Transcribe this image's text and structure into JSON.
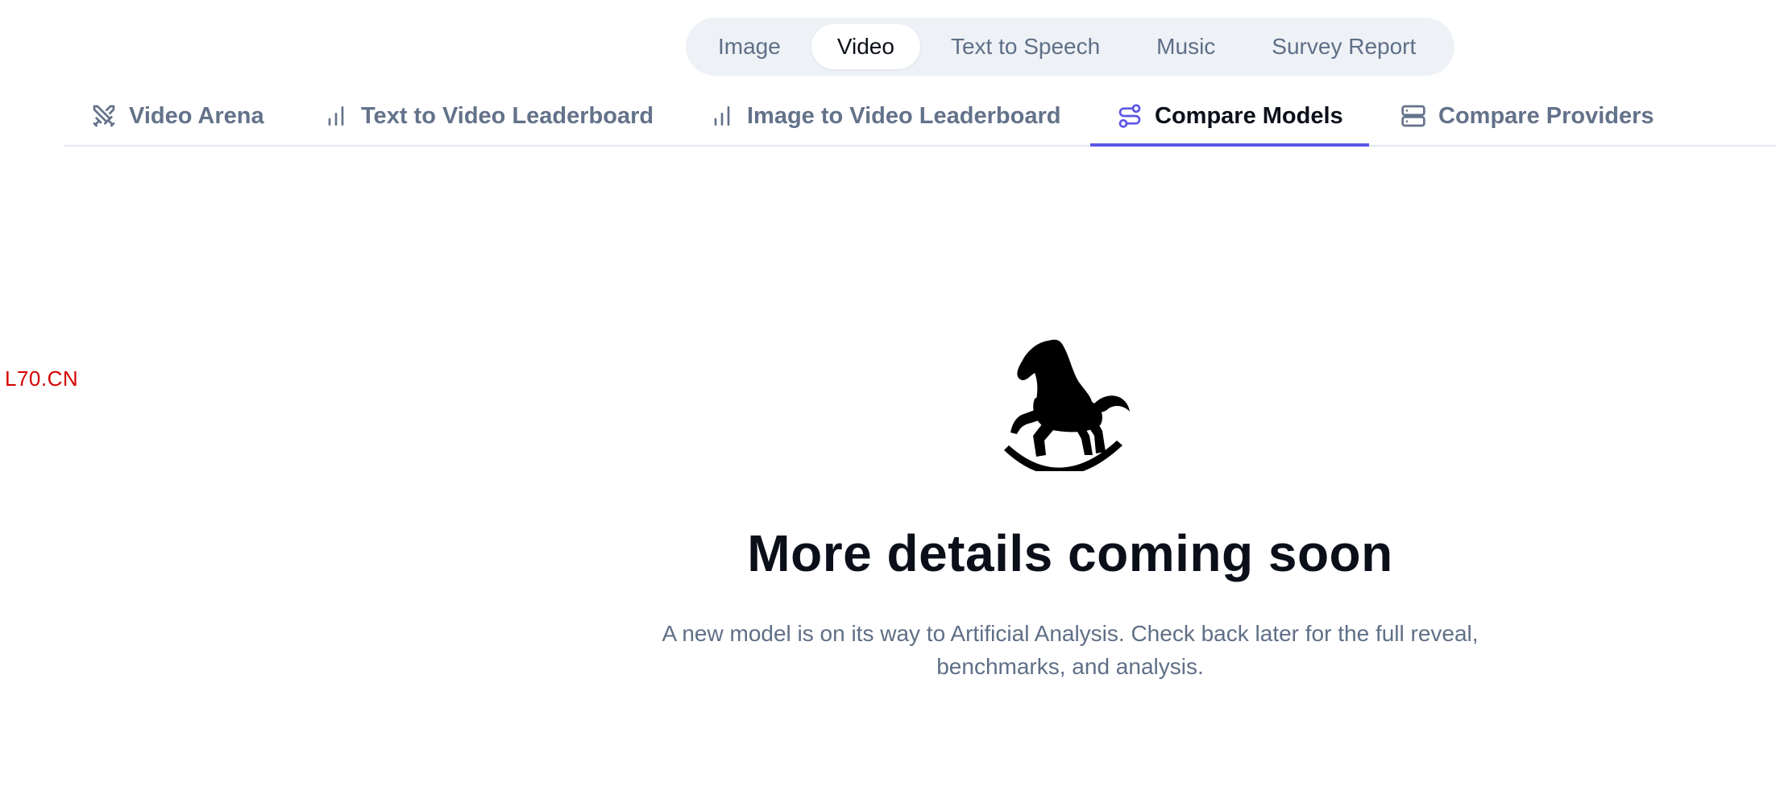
{
  "category_switcher": {
    "items": [
      {
        "label": "Image",
        "active": false
      },
      {
        "label": "Video",
        "active": true
      },
      {
        "label": "Text to Speech",
        "active": false
      },
      {
        "label": "Music",
        "active": false
      },
      {
        "label": "Survey Report",
        "active": false
      }
    ]
  },
  "tabs": {
    "items": [
      {
        "label": "Video Arena",
        "icon": "crossed-swords-icon",
        "active": false
      },
      {
        "label": "Text to Video Leaderboard",
        "icon": "bar-chart-icon",
        "active": false
      },
      {
        "label": "Image to Video Leaderboard",
        "icon": "bar-chart-icon",
        "active": false
      },
      {
        "label": "Compare Models",
        "icon": "workflow-icon",
        "active": true
      },
      {
        "label": "Compare Providers",
        "icon": "server-icon",
        "active": false
      }
    ],
    "active_color": "#5b57e6"
  },
  "watermark": {
    "text": "L70.CN",
    "color": "#d40000"
  },
  "coming_soon": {
    "icon": "rocking-horse-icon",
    "title": "More details coming soon",
    "description": "A new model is on its way to Artificial Analysis. Check back later for the full reveal, benchmarks, and analysis."
  }
}
